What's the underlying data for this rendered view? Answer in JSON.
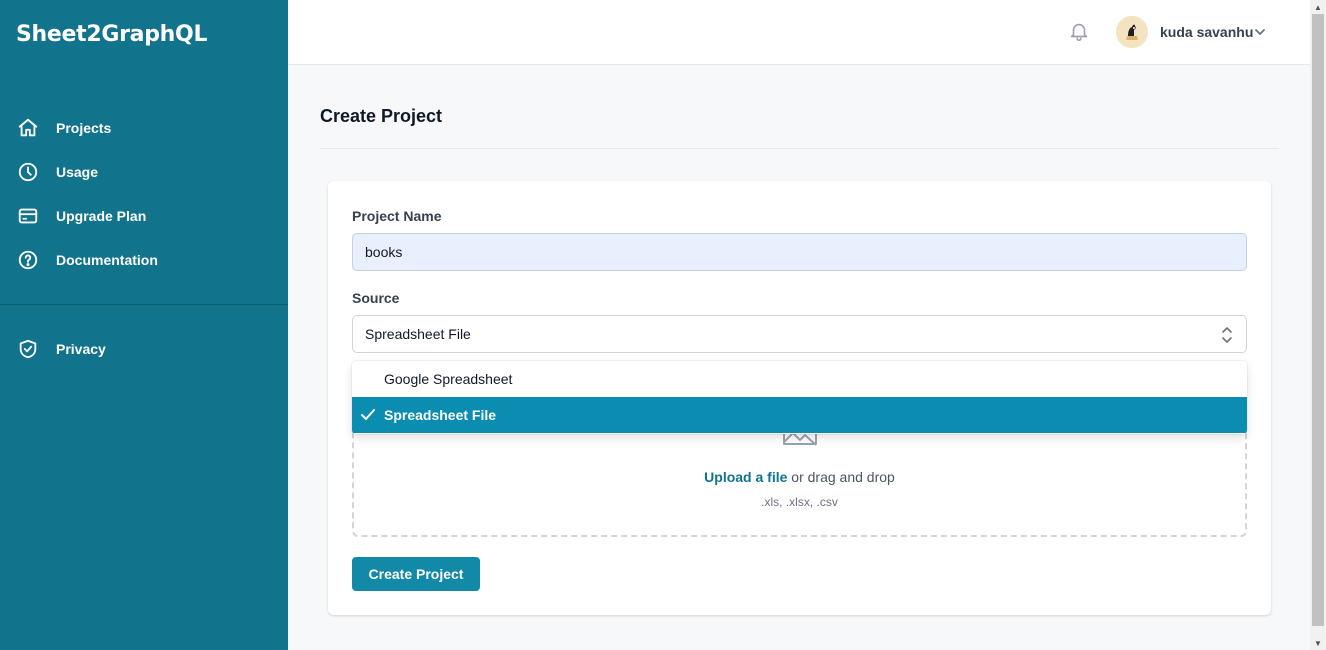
{
  "brand": "Sheet2GraphQL",
  "sidebar": {
    "items": [
      {
        "label": "Projects",
        "icon": "home-icon"
      },
      {
        "label": "Usage",
        "icon": "clock-icon"
      },
      {
        "label": "Upgrade Plan",
        "icon": "credit-card-icon"
      },
      {
        "label": "Documentation",
        "icon": "question-circle-icon"
      }
    ],
    "secondary": [
      {
        "label": "Privacy",
        "icon": "shield-check-icon"
      }
    ]
  },
  "topbar": {
    "user_name": "kuda savanhu",
    "icons": [
      "bell-icon",
      "avatar",
      "chevron-down-icon"
    ]
  },
  "page": {
    "title": "Create Project"
  },
  "form": {
    "project_name_label": "Project Name",
    "project_name_value": "books",
    "source_label": "Source",
    "source_value": "Spreadsheet File",
    "source_options": [
      {
        "label": "Google Spreadsheet",
        "selected": false
      },
      {
        "label": "Spreadsheet File",
        "selected": true
      }
    ],
    "upload": {
      "link_text": "Upload a file",
      "rest_text": " or drag and drop",
      "file_types": ".xls, .xlsx, .csv",
      "icon": "image-icon"
    },
    "submit_label": "Create Project"
  },
  "colors": {
    "sidebar_bg": "#12748c",
    "primary_button": "#1289a7",
    "selected_option": "#0a8db0",
    "link": "#0e7490"
  }
}
